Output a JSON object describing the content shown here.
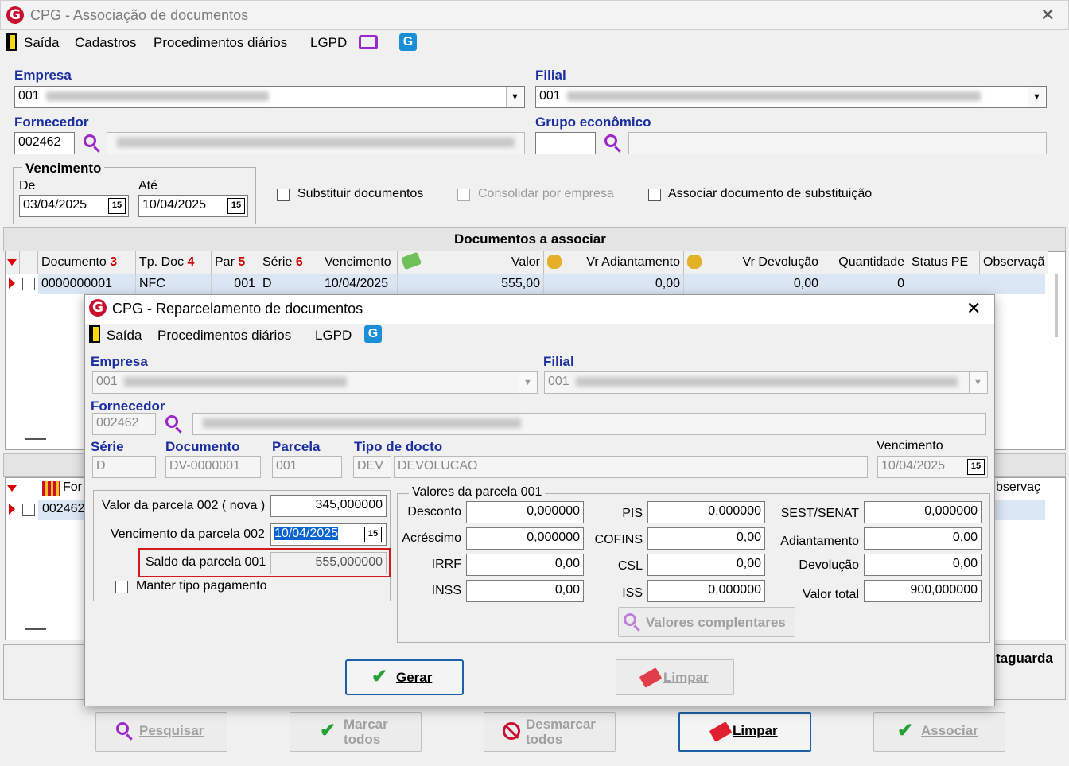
{
  "main": {
    "title": "CPG - Associação de documentos",
    "close_glyph": "✕",
    "menu": {
      "exit": "Saída",
      "cad": "Cadastros",
      "proc": "Procedimentos diários",
      "lgpd": "LGPD"
    },
    "empresa_label": "Empresa",
    "empresa_code": "001",
    "filial_label": "Filial",
    "filial_code": "001",
    "fornecedor_label": "Fornecedor",
    "fornecedor_code": "002462",
    "grupo_label": "Grupo econômico",
    "vencimento": {
      "title": "Vencimento",
      "de_label": "De",
      "de_value": "03/04/2025",
      "ate_label": "Até",
      "ate_value": "10/04/2025"
    },
    "chk_substituir": "Substituir documentos",
    "chk_consolidar": "Consolidar por empresa",
    "chk_associar": "Associar documento de substituição",
    "grid_title": "Documentos a associar",
    "columns": [
      "Documento",
      "Tp. Doc",
      "Par",
      "Série",
      "Vencimento",
      "Valor",
      "Vr Adiantamento",
      "Vr Devolução",
      "Quantidade",
      "Status PE",
      "Observaçã"
    ],
    "sort_nums": {
      "doc": "3",
      "tp": "4",
      "par": "5",
      "serie": "6"
    },
    "row": {
      "documento": "0000000001",
      "tpdoc": "NFC",
      "par": "001",
      "serie": "D",
      "vencimento": "10/04/2025",
      "valor": "555,00",
      "vr_adiant": "0,00",
      "vr_dev": "0,00",
      "quantidade": "0"
    },
    "grid2_col1": "For",
    "grid2_col_obs": "bservaç",
    "grid2_row": "002462",
    "salvaguarda_partial": "taguarda",
    "buttons": {
      "pesquisar": "Pesquisar",
      "marcar1": "Marcar",
      "marcar2": "todos",
      "desmarcar1": "Desmarcar",
      "desmarcar2": "todos",
      "limpar": "Limpar",
      "associar": "Associar"
    }
  },
  "dialog": {
    "title": "CPG - Reparcelamento de documentos",
    "close_glyph": "✕",
    "menu": {
      "exit": "Saída",
      "proc": "Procedimentos diários",
      "lgpd": "LGPD"
    },
    "empresa_label": "Empresa",
    "empresa_code": "001",
    "filial_label": "Filial",
    "filial_code": "001",
    "fornecedor_label": "Fornecedor",
    "fornecedor_code": "002462",
    "serie_label": "Série",
    "serie_value": "D",
    "documento_label": "Documento",
    "documento_value": "DV-0000001",
    "parcela_label": "Parcela",
    "parcela_value": "001",
    "tipo_label": "Tipo de docto",
    "tipo_code": "DEV",
    "tipo_desc": "DEVOLUCAO",
    "venc_label": "Vencimento",
    "venc_value": "10/04/2025",
    "valor_parcela_label": "Valor da parcela 002 ( nova )",
    "valor_parcela_value": "345,000000",
    "venc_parcela_label": "Vencimento da parcela 002",
    "venc_parcela_value": "10/04/2025",
    "saldo_label": "Saldo da parcela 001",
    "saldo_value": "555,000000",
    "manter_label": "Manter tipo pagamento",
    "valores_title": "Valores da parcela 001",
    "desconto_label": "Desconto",
    "desconto": "0,000000",
    "acrescimo_label": "Acréscimo",
    "acrescimo": "0,000000",
    "irrf_label": "IRRF",
    "irrf": "0,00",
    "inss_label": "INSS",
    "inss": "0,00",
    "pis_label": "PIS",
    "pis": "0,000000",
    "cofins_label": "COFINS",
    "cofins": "0,00",
    "csl_label": "CSL",
    "csl": "0,00",
    "iss_label": "ISS",
    "iss": "0,000000",
    "sest_label": "SEST/SENAT",
    "sest": "0,000000",
    "adiant_label": "Adiantamento",
    "adiant": "0,00",
    "devol_label": "Devolução",
    "devol": "0,00",
    "total_label": "Valor total",
    "total": "900,000000",
    "valores_btn": "Valores complentares",
    "gerar_btn": "Gerar",
    "limpar_btn": "Limpar"
  }
}
